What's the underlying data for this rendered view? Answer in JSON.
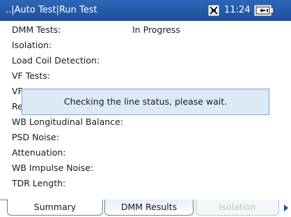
{
  "titlebar": {
    "title": "..|Auto Test|Run Test",
    "time": "11:24",
    "network_icon": "network-disconnected-icon",
    "battery_icon": "battery-charging-icon"
  },
  "rows": [
    {
      "label": "DMM Tests:",
      "value": "In Progress"
    },
    {
      "label": "Isolation:",
      "value": ""
    },
    {
      "label": "Load Coil Detection:",
      "value": ""
    },
    {
      "label": "VF Tests:",
      "value": ""
    },
    {
      "label": "VF",
      "value": ""
    },
    {
      "label": "Re",
      "value": ""
    },
    {
      "label": "WB Longitudinal Balance:",
      "value": ""
    },
    {
      "label": "PSD Noise:",
      "value": ""
    },
    {
      "label": "Attenuation:",
      "value": ""
    },
    {
      "label": "WB Impulse Noise:",
      "value": ""
    },
    {
      "label": "TDR Length:",
      "value": ""
    }
  ],
  "dialog": {
    "message": "Checking the line status, please wait."
  },
  "tabs": [
    {
      "label": "Summary",
      "state": "active"
    },
    {
      "label": "DMM Results",
      "state": "enabled"
    },
    {
      "label": "Isolation",
      "state": "disabled"
    }
  ],
  "colors": {
    "titlebar": "#2360b0",
    "dialog_bg": "#dce9f7",
    "dialog_border": "#7ea4d4"
  }
}
